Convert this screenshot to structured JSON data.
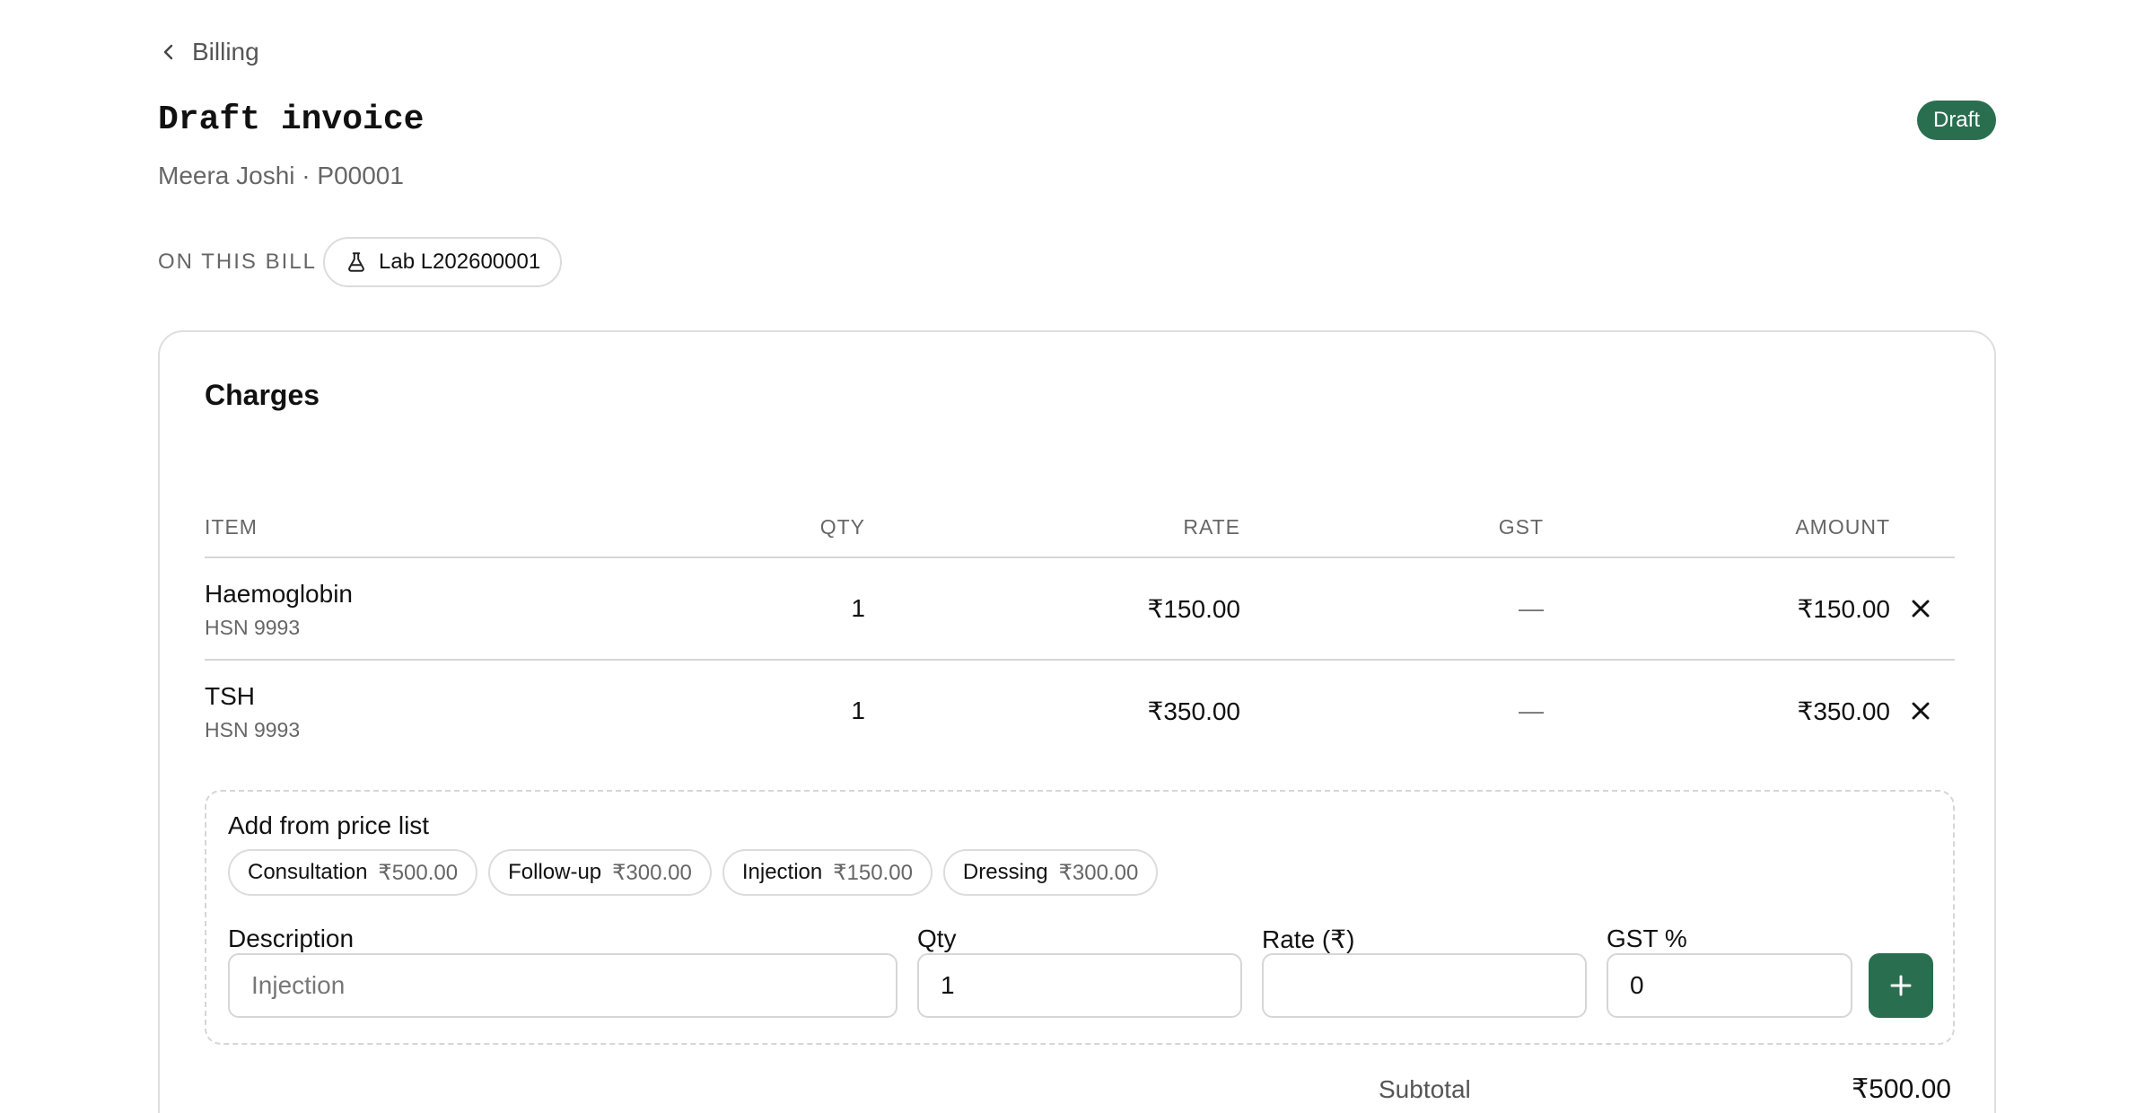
{
  "nav": {
    "back_label": "Billing"
  },
  "header": {
    "title": "Draft invoice",
    "subtitle": "Meera Joshi · P00001",
    "status": "Draft"
  },
  "on_bill": {
    "label": "ON THIS BILL",
    "chip": "Lab L202600001",
    "chip_icon": "flask-icon"
  },
  "charges": {
    "title": "Charges",
    "columns": {
      "item": "ITEM",
      "qty": "QTY",
      "rate": "RATE",
      "gst": "GST",
      "amount": "AMOUNT"
    },
    "rows": [
      {
        "name": "Haemoglobin",
        "hsn": "HSN 9993",
        "qty": "1",
        "rate": "₹150.00",
        "gst": "—",
        "amount": "₹150.00"
      },
      {
        "name": "TSH",
        "hsn": "HSN 9993",
        "qty": "1",
        "rate": "₹350.00",
        "gst": "—",
        "amount": "₹350.00"
      }
    ]
  },
  "add_form": {
    "title": "Add from price list",
    "price_list": [
      {
        "name": "Consultation",
        "price": "₹500.00"
      },
      {
        "name": "Follow-up",
        "price": "₹300.00"
      },
      {
        "name": "Injection",
        "price": "₹150.00"
      },
      {
        "name": "Dressing",
        "price": "₹300.00"
      }
    ],
    "description_label": "Description",
    "description_placeholder": "Injection",
    "qty_label": "Qty",
    "qty_value": "1",
    "rate_label": "Rate (₹)",
    "rate_value": "",
    "gst_label": "GST %",
    "gst_value": "0"
  },
  "totals": {
    "subtotal_label": "Subtotal",
    "subtotal_value": "₹500.00"
  },
  "colors": {
    "accent": "#2a6e50",
    "border": "#dedede",
    "muted_text": "#666666"
  }
}
